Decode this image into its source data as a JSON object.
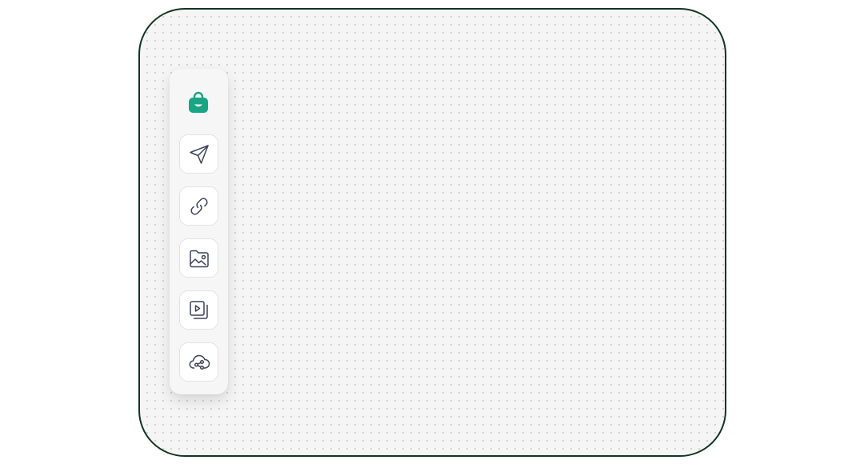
{
  "theme": {
    "frame_border": "#123524",
    "canvas_bg": "#f5f5f5",
    "brand": "#17a584",
    "icon_stroke": "#3c4259"
  },
  "toolbar": {
    "logo": {
      "icon": "shopping-bag-smile-icon"
    },
    "buttons": [
      {
        "icon": "send-icon"
      },
      {
        "icon": "link-icon"
      },
      {
        "icon": "image-folder-icon"
      },
      {
        "icon": "video-playlist-icon"
      },
      {
        "icon": "cloud-share-icon"
      }
    ]
  }
}
